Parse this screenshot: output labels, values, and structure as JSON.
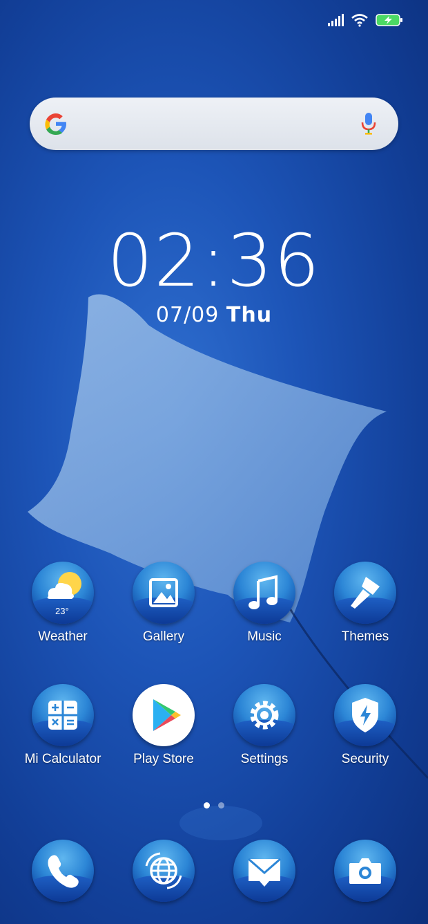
{
  "status_bar": {
    "icons": [
      "signal-icon",
      "wifi-icon",
      "battery-charging-icon"
    ]
  },
  "search": {
    "icons": [
      "google-logo-icon",
      "microphone-icon"
    ]
  },
  "clock": {
    "time": "02:36",
    "date": "07/09",
    "day": "Thu"
  },
  "apps": [
    {
      "label": "Weather",
      "icon": "weather-icon",
      "temp": "23°"
    },
    {
      "label": "Gallery",
      "icon": "gallery-icon"
    },
    {
      "label": "Music",
      "icon": "music-icon"
    },
    {
      "label": "Themes",
      "icon": "themes-icon"
    },
    {
      "label": "Mi Calculator",
      "icon": "calculator-icon"
    },
    {
      "label": "Play Store",
      "icon": "play-store-icon"
    },
    {
      "label": "Settings",
      "icon": "settings-icon"
    },
    {
      "label": "Security",
      "icon": "security-icon"
    }
  ],
  "page_indicator": {
    "pages": 2,
    "current": 1
  },
  "dock": [
    {
      "icon": "phone-icon"
    },
    {
      "icon": "browser-icon"
    },
    {
      "icon": "messages-icon"
    },
    {
      "icon": "camera-icon"
    }
  ],
  "colors": {
    "wallpaper": "#1d55b8",
    "battery": "#4cd964",
    "icon_theme": "#2c86d6"
  }
}
